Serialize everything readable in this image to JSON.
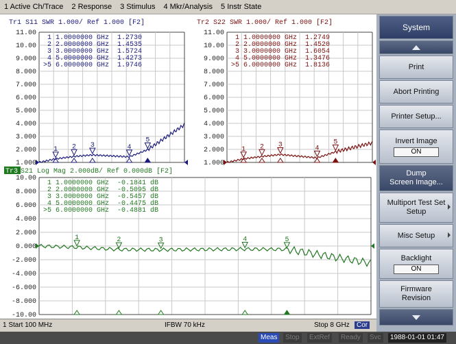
{
  "menu": [
    "1 Active Ch/Trace",
    "2 Response",
    "3 Stimulus",
    "4 Mkr/Analysis",
    "5 Instr State"
  ],
  "colors": {
    "tr1": "#1a1a7a",
    "tr2": "#7a1010",
    "tr3": "#227722"
  },
  "trace1": {
    "title": "Tr1  S11  SWR 1.000/ Ref 1.000 [F2]",
    "yticks": [
      "11.00",
      "10.00",
      "9.000",
      "8.000",
      "7.000",
      "6.000",
      "5.000",
      "4.000",
      "3.000",
      "2.000",
      "1.000"
    ],
    "markers": [
      {
        "id": "1",
        "freq": "1.0000000 GHz",
        "val": "1.2730"
      },
      {
        "id": "2",
        "freq": "2.0000000 GHz",
        "val": "1.4535"
      },
      {
        "id": "3",
        "freq": "3.0000000 GHz",
        "val": "1.5724"
      },
      {
        "id": "4",
        "freq": "5.0000000 GHz",
        "val": "1.4273"
      },
      {
        "id": ">5",
        "freq": "6.0000000 GHz",
        "val": "1.9746"
      }
    ]
  },
  "trace2": {
    "title": "Tr2  S22  SWR 1.000/ Ref 1.000 [F2]",
    "yticks": [
      "11.00",
      "10.00",
      "9.000",
      "8.000",
      "7.000",
      "6.000",
      "5.000",
      "4.000",
      "3.000",
      "2.000",
      "1.000"
    ],
    "markers": [
      {
        "id": "1",
        "freq": "1.0000000 GHz",
        "val": "1.2749"
      },
      {
        "id": "2",
        "freq": "2.0000000 GHz",
        "val": "1.4520"
      },
      {
        "id": "3",
        "freq": "3.0000000 GHz",
        "val": "1.6054"
      },
      {
        "id": "4",
        "freq": "5.0000000 GHz",
        "val": "1.3476"
      },
      {
        "id": ">5",
        "freq": "6.0000000 GHz",
        "val": "1.8136"
      }
    ]
  },
  "trace3": {
    "badge": "Tr3",
    "title": " S21  Log Mag 2.000dB/ Ref 0.000dB [F2]",
    "yticks": [
      "10.00",
      "8.000",
      "6.000",
      "4.000",
      "2.000",
      "0.000",
      "-2.000",
      "-4.000",
      "-6.000",
      "-8.000",
      "-10.00"
    ],
    "markers": [
      {
        "id": "1",
        "freq": "1.0000000 GHz",
        "val": "-0.1841 dB"
      },
      {
        "id": "2",
        "freq": "2.0000000 GHz",
        "val": "-0.5095 dB"
      },
      {
        "id": "3",
        "freq": "3.0000000 GHz",
        "val": "-0.5457 dB"
      },
      {
        "id": "4",
        "freq": "5.0000000 GHz",
        "val": "-0.4475 dB"
      },
      {
        "id": ">5",
        "freq": "6.0000000 GHz",
        "val": "-0.4881 dB"
      }
    ]
  },
  "chart_data": [
    {
      "type": "line",
      "title": "Tr1  S11  SWR 1.000/ Ref 1.000 [F2]",
      "xlim": [
        0.1,
        8
      ],
      "ylim": [
        1,
        11
      ],
      "series": [
        {
          "values": [
            [
              0.1,
              1.0
            ],
            [
              1,
              1.273
            ],
            [
              2,
              1.4535
            ],
            [
              3,
              1.5724
            ],
            [
              5,
              1.4273
            ],
            [
              6,
              1.9746
            ],
            [
              8,
              3.9
            ]
          ]
        }
      ]
    },
    {
      "type": "line",
      "title": "Tr2  S22  SWR 1.000/ Ref 1.000 [F2]",
      "xlim": [
        0.1,
        8
      ],
      "ylim": [
        1,
        11
      ],
      "series": [
        {
          "values": [
            [
              0.1,
              1.0
            ],
            [
              1,
              1.2749
            ],
            [
              2,
              1.452
            ],
            [
              3,
              1.6054
            ],
            [
              5,
              1.3476
            ],
            [
              6,
              1.8136
            ],
            [
              8,
              2.5
            ]
          ]
        }
      ]
    },
    {
      "type": "line",
      "title": "Tr3  S21  Log Mag 2.000dB/ Ref 0.000dB [F2]",
      "xlim": [
        0.1,
        8
      ],
      "ylim": [
        -10,
        10
      ],
      "series": [
        {
          "values": [
            [
              0.1,
              0
            ],
            [
              1,
              -0.1841
            ],
            [
              2,
              -0.5095
            ],
            [
              3,
              -0.5457
            ],
            [
              5,
              -0.4475
            ],
            [
              6,
              -0.4881
            ],
            [
              8,
              -2.5
            ]
          ]
        }
      ]
    }
  ],
  "bottom": {
    "start": "1  Start 100 MHz",
    "ifbw": "IFBW 70 kHz",
    "stop": "Stop 8 GHz",
    "cor": "Cor"
  },
  "softkeys": {
    "system": "System",
    "print": "Print",
    "abort": "Abort Printing",
    "printer_setup": "Printer Setup...",
    "invert": "Invert Image",
    "invert_state": "ON",
    "dump1": "Dump",
    "dump2": "Screen Image...",
    "multiport1": "Multiport Test Set",
    "multiport2": "Setup",
    "misc": "Misc Setup",
    "backlight": "Backlight",
    "backlight_state": "ON",
    "firmware1": "Firmware",
    "firmware2": "Revision"
  },
  "status": {
    "meas": "Meas",
    "stop": "Stop",
    "extref": "ExtRef",
    "ready": "Ready",
    "svc": "Svc",
    "clock": "1988-01-01 01:47"
  }
}
